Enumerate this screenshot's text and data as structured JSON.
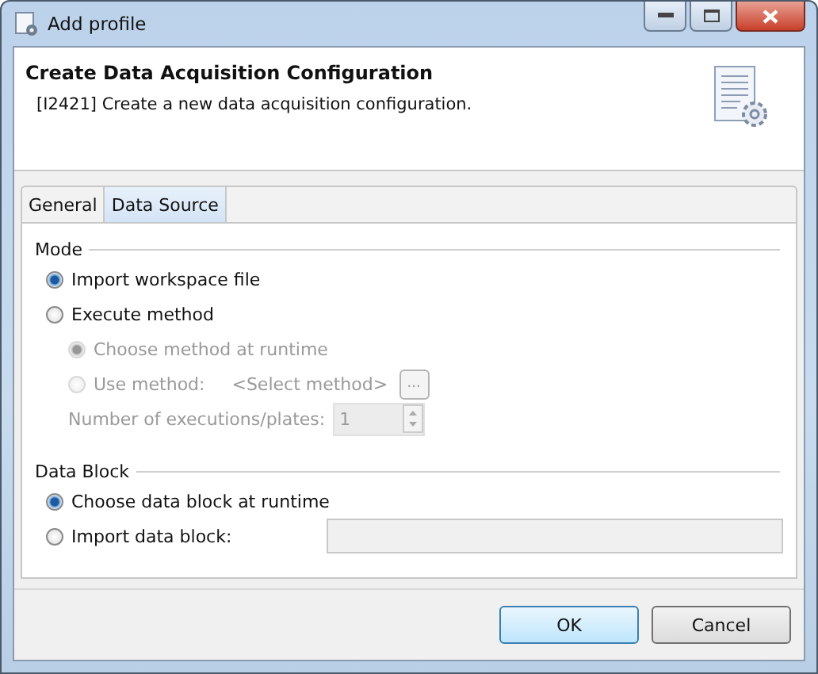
{
  "window": {
    "title": "Add profile"
  },
  "header": {
    "title": "Create Data Acquisition Configuration",
    "description": "[I2421] Create a new data acquisition configuration."
  },
  "tabs": [
    {
      "label": "General",
      "selected": false
    },
    {
      "label": "Data Source",
      "selected": true
    }
  ],
  "mode": {
    "title": "Mode",
    "options": [
      {
        "label": "Import workspace file",
        "selected": true,
        "disabled": false
      },
      {
        "label": "Execute method",
        "selected": false,
        "disabled": false,
        "children": [
          {
            "label": "Choose method at runtime",
            "selected": true,
            "disabled": true
          },
          {
            "label": "Use method:",
            "selected": false,
            "disabled": true,
            "value": "<Select method>",
            "browse": "..."
          }
        ]
      }
    ],
    "executions": {
      "label": "Number of executions/plates:",
      "value": "1",
      "disabled": true
    }
  },
  "data_block": {
    "title": "Data Block",
    "options": [
      {
        "label": "Choose data block at runtime",
        "selected": true,
        "disabled": false
      },
      {
        "label": "Import data block:",
        "selected": false,
        "disabled": false,
        "field": true
      }
    ]
  },
  "buttons": [
    {
      "label": "OK",
      "default": true
    },
    {
      "label": "Cancel",
      "default": false
    }
  ]
}
